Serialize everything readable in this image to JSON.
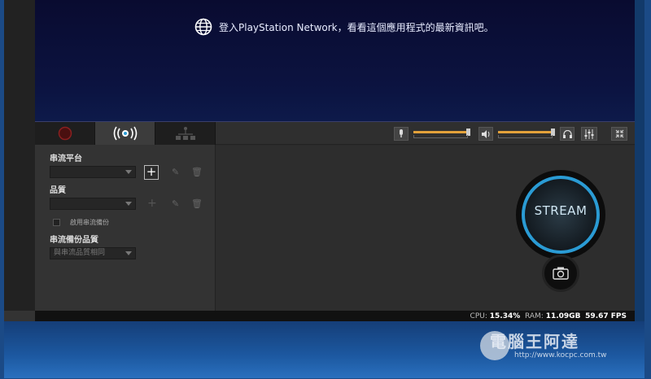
{
  "banner": {
    "message": "登入PlayStation Network，看看這個應用程式的最新資訊吧。"
  },
  "tabs": [
    {
      "name": "record-tab",
      "icon": "record-icon"
    },
    {
      "name": "broadcast-tab",
      "icon": "broadcast-icon",
      "active": true
    },
    {
      "name": "network-tab",
      "icon": "network-icon"
    }
  ],
  "side": {
    "platform_label": "串流平台",
    "platform_value": "",
    "quality_label": "品質",
    "quality_value": "",
    "backup_checkbox_label": "啟用串流備份",
    "backup_quality_label": "串流備份品質",
    "backup_quality_value": "與串流品質相同"
  },
  "toolbar": {
    "mic_level": 0.95,
    "speaker_level": 0.95
  },
  "stream_button": {
    "label": "STREAM"
  },
  "status": {
    "cpu_label": "CPU:",
    "cpu_value": "15.34%",
    "ram_label": "RAM:",
    "ram_value": "11.09GB",
    "fps_value": "59.67 FPS"
  },
  "watermark": {
    "title": "電腦王阿達",
    "url": "http://www.kocpc.com.tw"
  },
  "colors": {
    "accent": "#2a9bd4",
    "slider": "#e3a13a",
    "banner_bg": "#0a0e36"
  }
}
